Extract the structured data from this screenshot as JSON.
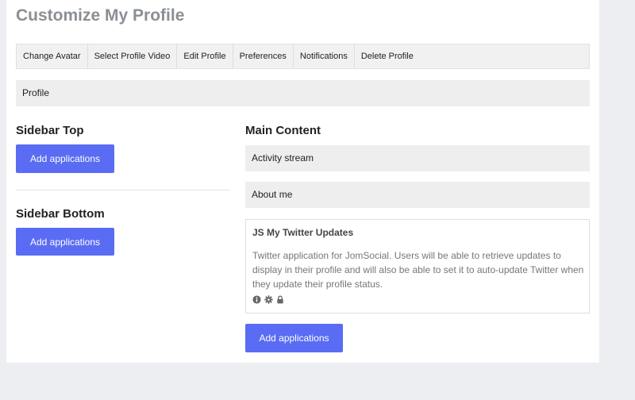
{
  "page": {
    "title": "Customize My Profile"
  },
  "tabs": [
    {
      "label": "Change Avatar"
    },
    {
      "label": "Select Profile Video"
    },
    {
      "label": "Edit Profile"
    },
    {
      "label": "Preferences"
    },
    {
      "label": "Notifications"
    },
    {
      "label": "Delete Profile"
    }
  ],
  "profile_bar": {
    "label": "Profile"
  },
  "sidebar_top": {
    "heading": "Sidebar Top",
    "button_label": "Add applications"
  },
  "sidebar_bottom": {
    "heading": "Sidebar Bottom",
    "button_label": "Add applications"
  },
  "main": {
    "heading": "Main Content",
    "modules": [
      {
        "label": "Activity stream"
      },
      {
        "label": "About me"
      }
    ],
    "app": {
      "title": "JS My Twitter Updates",
      "description": "Twitter application for JomSocial. Users will be able to retrieve updates to display in their profile and will also be able to set it to auto-update Twitter when they update their profile status.",
      "icons": [
        "info-icon",
        "gear-icon",
        "lock-icon"
      ]
    },
    "button_label": "Add applications"
  },
  "colors": {
    "accent": "#5a6cf3",
    "title_gray": "#8a8f94",
    "bar_gray": "#eeeeee"
  }
}
